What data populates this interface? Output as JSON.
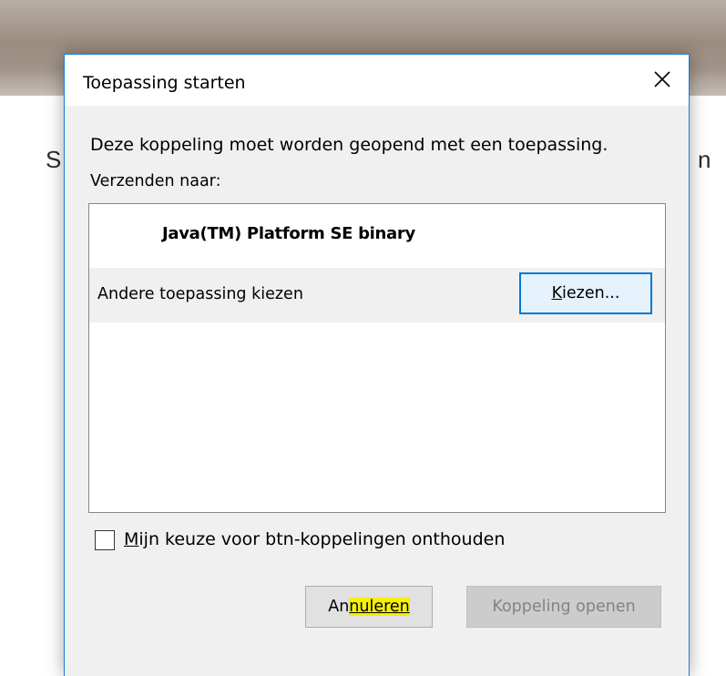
{
  "dialog": {
    "title": "Toepassing starten",
    "message": "Deze koppeling moet worden geopend met een toepassing.",
    "send_to_label": "Verzenden naar:",
    "apps": [
      {
        "name": "Java(TM) Platform SE binary"
      }
    ],
    "other_app_label": "Andere toepassing kiezen",
    "choose_button": {
      "mnemonic": "K",
      "rest": "iezen..."
    },
    "remember_checkbox": {
      "mnemonic": "M",
      "rest": "ijn keuze voor btn-koppelingen onthouden",
      "checked": false
    },
    "cancel_button": {
      "before": "An",
      "highlighted": "nuleren"
    },
    "open_button": {
      "label": "Koppeling openen",
      "enabled": false
    }
  },
  "background": {
    "left_char": "S",
    "right_char": "n"
  },
  "colors": {
    "accent": "#0078d7",
    "highlight": "#f5f000",
    "dialog_bg": "#f0f0f0"
  },
  "icons": {
    "close": "close-icon"
  }
}
